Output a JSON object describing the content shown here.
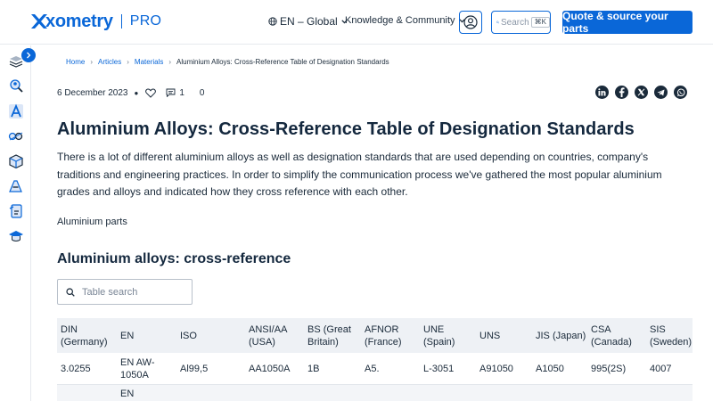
{
  "header": {
    "logo_word": "xometry",
    "logo_tier": "PRO",
    "language": "EN – Global",
    "knowledge": "Knowledge & Community",
    "search_placeholder": "Search",
    "search_shortcut": "K",
    "quote_button": "Quote & source your parts",
    "accent_color": "#0a67d8"
  },
  "sidebar": {
    "icons": [
      "layers-icon",
      "search-person-icon",
      "letter-a-icon",
      "pipes-icon",
      "cube-icon",
      "materials-icon",
      "document-icon",
      "graduation-cap-icon"
    ]
  },
  "breadcrumb": {
    "items": [
      "Home",
      "Articles",
      "Materials"
    ],
    "current": "Aluminium Alloys: Cross-Reference Table of Designation Standards"
  },
  "meta": {
    "date": "6 December 2023",
    "comments": "1",
    "views": "0"
  },
  "share": {
    "icons": [
      "linkedin-icon",
      "facebook-icon",
      "x-twitter-icon",
      "telegram-icon",
      "whatsapp-icon"
    ]
  },
  "article": {
    "title": "Aluminium Alloys: Cross-Reference Table of Designation Standards",
    "intro": "There is a lot of different aluminium alloys as well as designation standards that are used depending on countries, company's traditions and engineering practices. In order to simplify the communication process we've gathered the most popular aluminium grades and alloys and indicated how they cross reference with each other.",
    "image_caption": "Aluminium parts",
    "section_title": "Aluminium alloys: cross-reference"
  },
  "table": {
    "search_placeholder": "Table search",
    "headers": [
      "DIN (Germany)",
      "EN",
      "ISO",
      "ANSI/AA (USA)",
      "BS (Great Britain)",
      "AFNOR (France)",
      "UNE (Spain)",
      "UNS",
      "JIS (Japan)",
      "CSA (Canada)",
      "SIS (Sweden)"
    ],
    "rows": [
      [
        "3.0255",
        "EN AW-1050A",
        "Al99,5",
        "AA1050A",
        "1B",
        "A5.",
        "L-3051",
        "A91050",
        "A1050",
        "995(2S)",
        "4007"
      ],
      [
        "",
        "EN",
        "",
        "",
        "",
        "",
        "",
        "",
        "",
        "",
        ""
      ]
    ]
  }
}
